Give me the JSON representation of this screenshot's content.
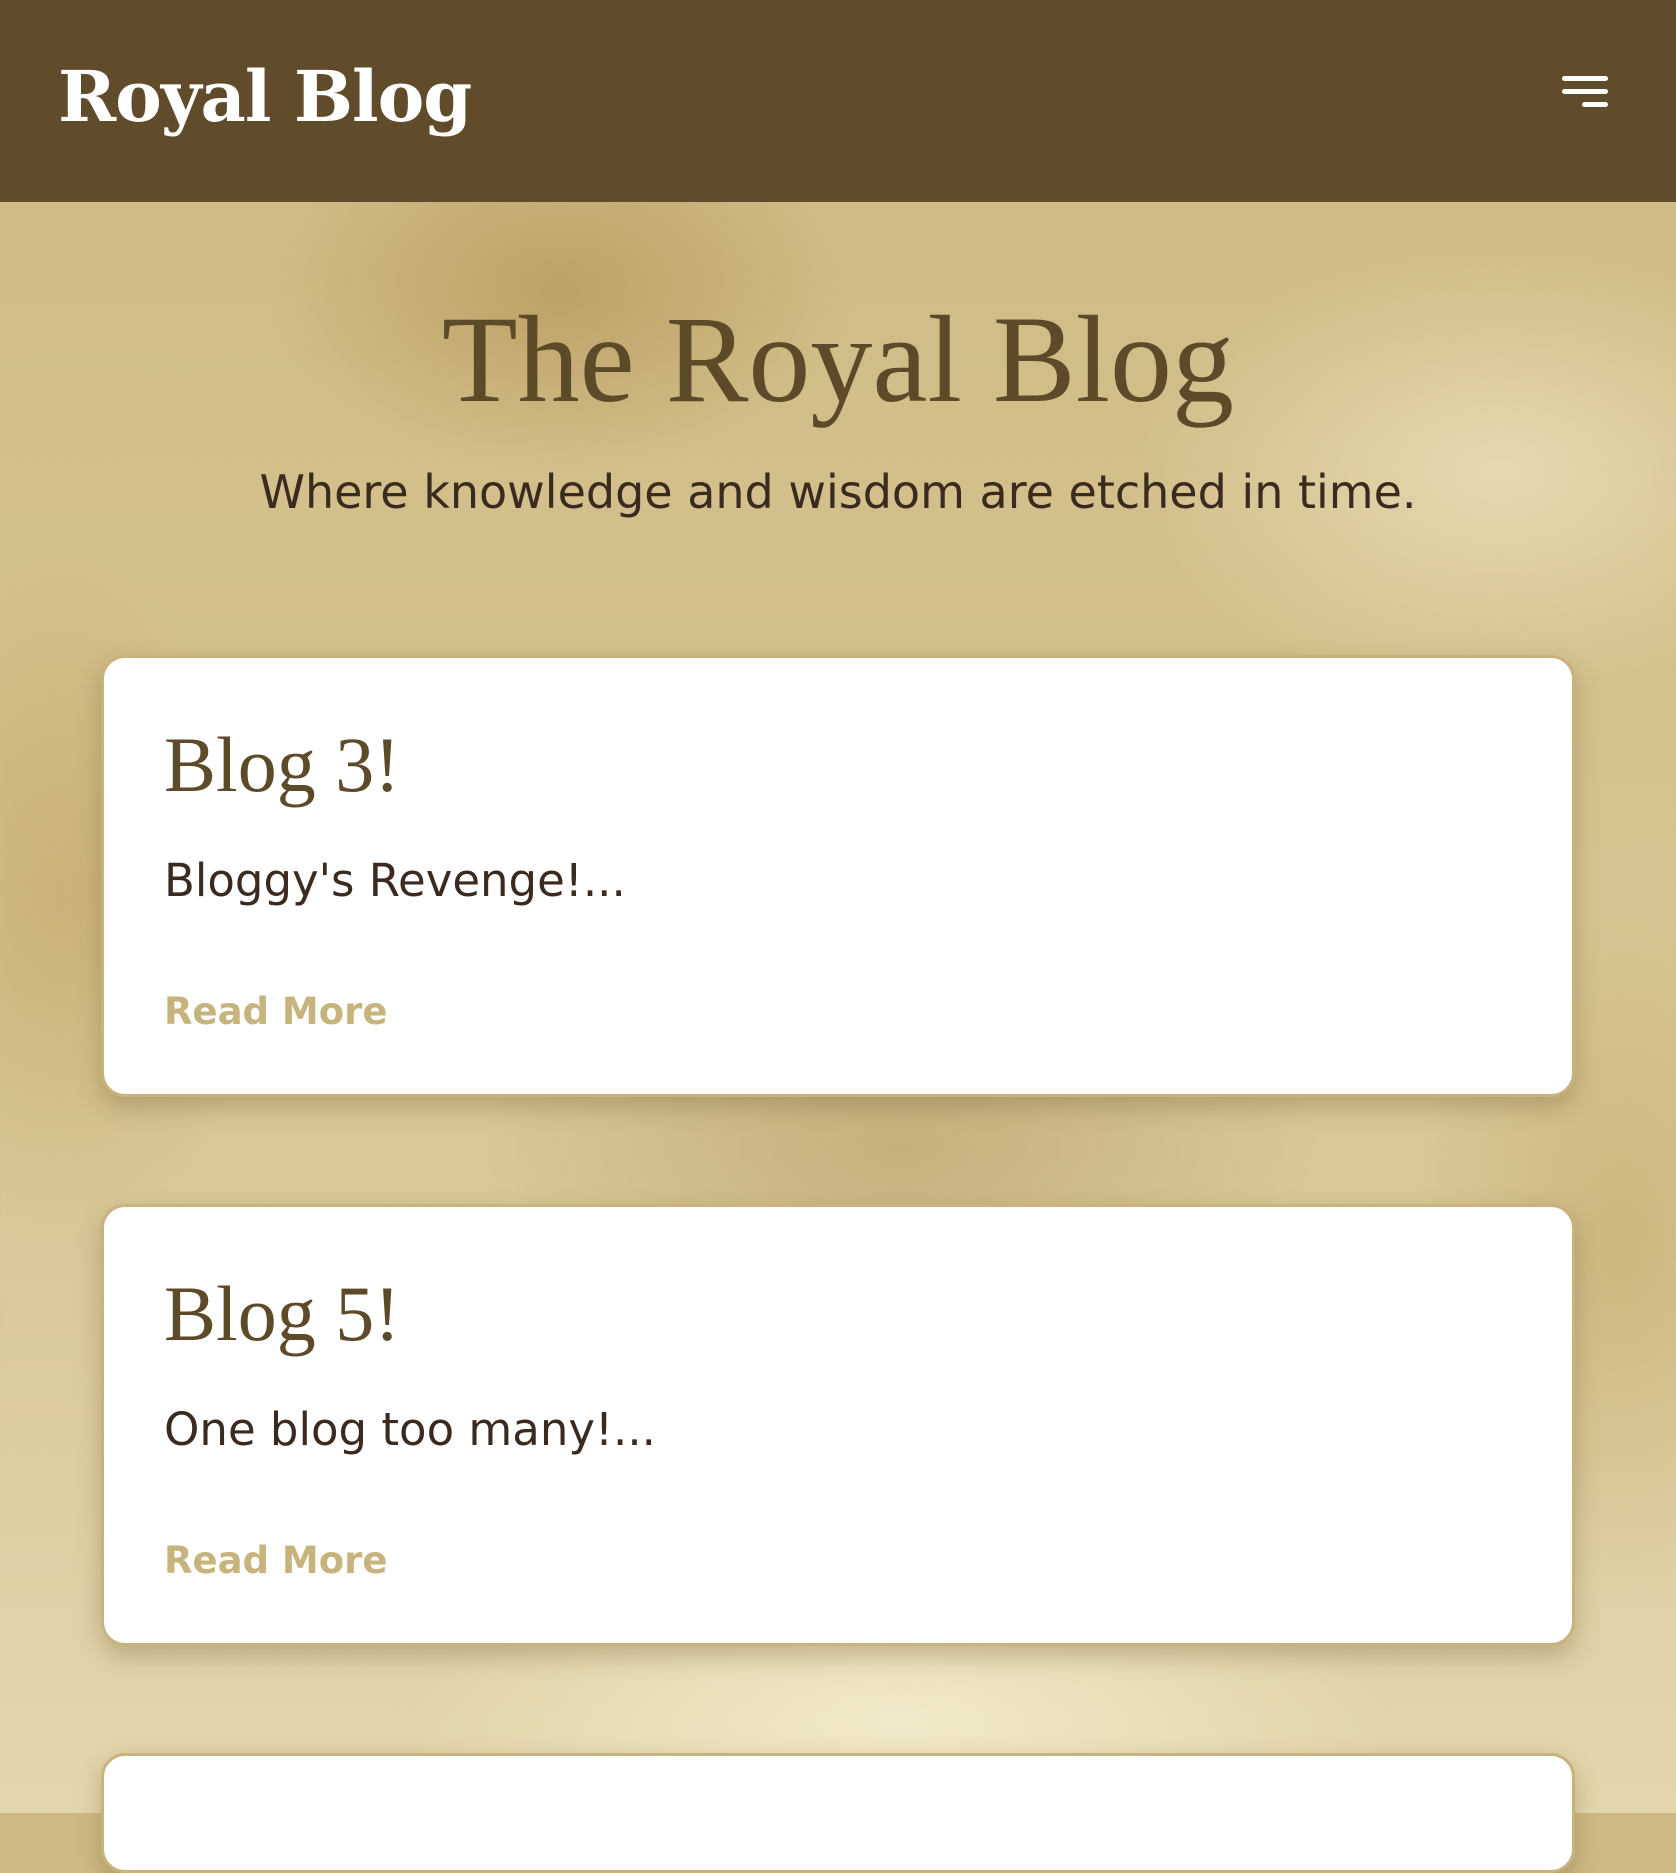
{
  "header": {
    "brand": "Royal Blog",
    "menu_icon": "hamburger-menu-icon"
  },
  "hero": {
    "title": "The Royal Blog",
    "subtitle": "Where knowledge and wisdom are etched in time."
  },
  "posts": [
    {
      "title": "Blog 3!",
      "excerpt": "Bloggy's Revenge!...",
      "link_label": "Read More"
    },
    {
      "title": "Blog 5!",
      "excerpt": "One blog too many!...",
      "link_label": "Read More"
    }
  ],
  "colors": {
    "header_bg": "#604c2a",
    "title_brown": "#5d4a28",
    "body_text": "#3a2a1f",
    "link_gold": "#c7b37c",
    "card_bg": "#ffffff"
  }
}
